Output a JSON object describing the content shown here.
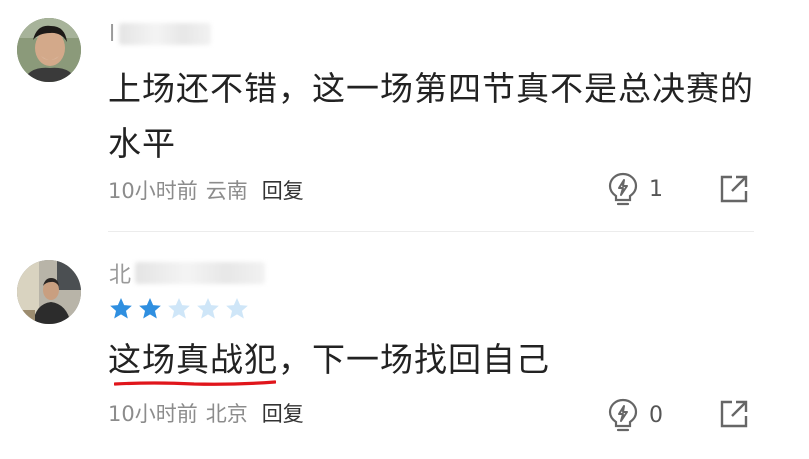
{
  "comments": [
    {
      "username_visible": "l",
      "text_line1": "上场还不错，这一场第四节真不是总决赛的",
      "text_line2": "水平",
      "time": "10小时前",
      "location": "云南",
      "reply_label": "回复",
      "likes": "1"
    },
    {
      "username_visible": "北",
      "rating": 2,
      "rating_max": 5,
      "text_highlight": "这场真战犯",
      "text_rest": "，下一场找回自己",
      "time": "10小时前",
      "location": "北京",
      "reply_label": "回复",
      "likes": "0"
    }
  ],
  "colors": {
    "star_filled": "#2f8fe0",
    "star_empty": "#cfe6f8",
    "underline": "#e0151b"
  }
}
